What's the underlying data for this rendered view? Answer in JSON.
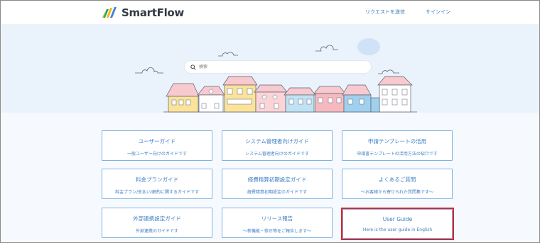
{
  "header": {
    "logo_text": "SmartFlow",
    "nav_request": "リクエストを送信",
    "nav_signin": "サインイン"
  },
  "search": {
    "placeholder": "検索"
  },
  "cards": [
    {
      "title": "ユーザーガイド",
      "desc": "一般ユーザー向けのガイドです"
    },
    {
      "title": "システム管理者向けガイド",
      "desc": "システム管理者向けのガイドです"
    },
    {
      "title": "申請テンプレートの活用",
      "desc": "申請書テンプレートの活用方法の紹介です"
    },
    {
      "title": "料金プランガイド",
      "desc": "料金プラン/支払い/解約に関するガイドです"
    },
    {
      "title": "経費精算初期設定ガイド",
      "desc": "経費精算初期設定のガイドです"
    },
    {
      "title": "よくあるご質問",
      "desc": "～お客様から寄せられた質問集です～"
    },
    {
      "title": "外部連携設定ガイド",
      "desc": "外部連携のガイドです"
    },
    {
      "title": "リリース報告",
      "desc": "～新機能・修正等をご報告します～"
    },
    {
      "title": "User Guide",
      "desc": "Here is the user guide in English"
    }
  ],
  "colors": {
    "accent": "#3f7ec4",
    "card_border": "#7fb3e3",
    "hero_bg": "#eaf2fb",
    "highlight": "#d9252a"
  }
}
